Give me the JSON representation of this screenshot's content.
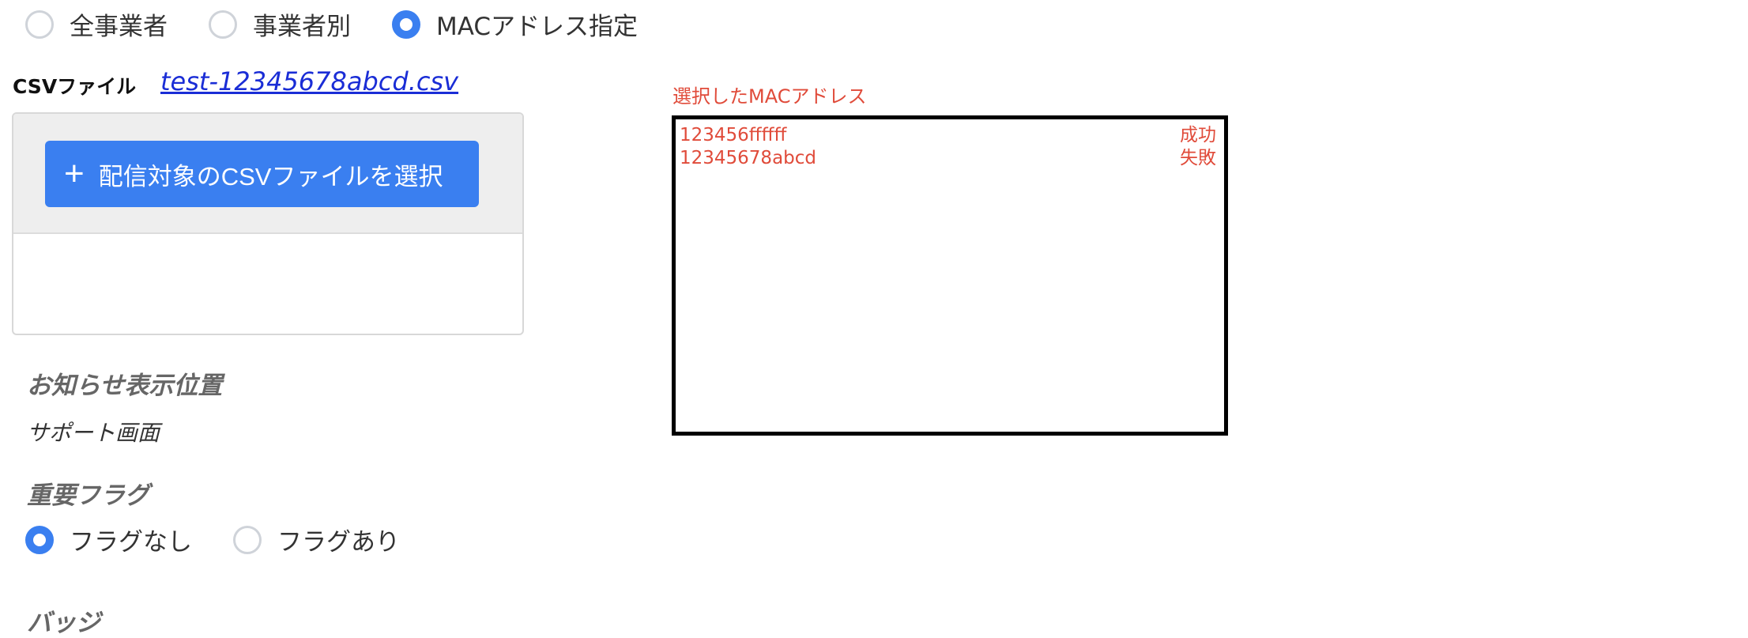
{
  "target": {
    "options": [
      {
        "label": "全事業者",
        "checked": false
      },
      {
        "label": "事業者別",
        "checked": false
      },
      {
        "label": "MACアドレス指定",
        "checked": true
      }
    ]
  },
  "csv": {
    "label": "CSVファイル",
    "file_name": "test-12345678abcd.csv",
    "select_button": "配信対象のCSVファイルを選択"
  },
  "mac": {
    "caption": "選択したMACアドレス",
    "rows": [
      {
        "address": "123456ffffff",
        "status": "成功"
      },
      {
        "address": "12345678abcd",
        "status": "失敗"
      }
    ]
  },
  "notice_position": {
    "title": "お知らせ表示位置",
    "value": "サポート画面"
  },
  "important_flag": {
    "title": "重要フラグ",
    "options": [
      {
        "label": "フラグなし",
        "checked": true
      },
      {
        "label": "フラグあり",
        "checked": false
      }
    ]
  },
  "badge": {
    "title": "バッジ"
  },
  "colors": {
    "accent": "#3a7ff0",
    "error_text": "#e04b3a",
    "link": "#1a2dd6"
  }
}
